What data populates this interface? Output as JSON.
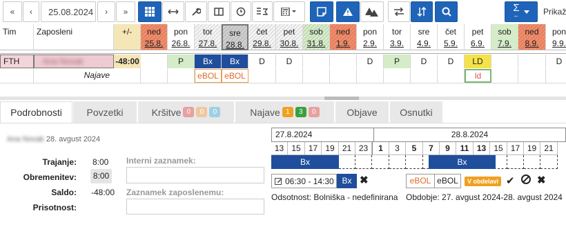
{
  "toolbar": {
    "date_value": "25.08.2024",
    "first_label": "«",
    "prev_label": "‹",
    "next_label": "›",
    "last_label": "»",
    "sigma_label": "Σ",
    "sigma_sub": "←",
    "prikaz_label": "Prikaž"
  },
  "header": {
    "tim": "Tim",
    "zaposleni": "Zaposleni",
    "balance": "+/-"
  },
  "days": [
    {
      "name": "ned",
      "date": "25.8.",
      "type": "holiday"
    },
    {
      "name": "pon",
      "date": "26.8.",
      "type": "normal"
    },
    {
      "name": "tor",
      "date": "27.8.",
      "type": "hatched"
    },
    {
      "name": "sre",
      "date": "28.8.",
      "type": "selected"
    },
    {
      "name": "čet",
      "date": "29.8.",
      "type": "hatched"
    },
    {
      "name": "pet",
      "date": "30.8.",
      "type": "hatched"
    },
    {
      "name": "sob",
      "date": "31.8.",
      "type": "weekend-hatched"
    },
    {
      "name": "ned",
      "date": "1.9.",
      "type": "holiday"
    },
    {
      "name": "pon",
      "date": "2.9.",
      "type": "normal"
    },
    {
      "name": "tor",
      "date": "3.9.",
      "type": "normal"
    },
    {
      "name": "sre",
      "date": "4.9.",
      "type": "normal"
    },
    {
      "name": "čet",
      "date": "5.9.",
      "type": "normal"
    },
    {
      "name": "pet",
      "date": "6.9.",
      "type": "normal"
    },
    {
      "name": "sob",
      "date": "7.9.",
      "type": "weekend"
    },
    {
      "name": "ned",
      "date": "8.9.",
      "type": "holiday"
    },
    {
      "name": "pon",
      "date": "9.9.",
      "type": "normal"
    }
  ],
  "employee": {
    "team": "FTH",
    "name": "Ana Novak",
    "balance": "-48:00",
    "najave": "Najave"
  },
  "schedule": [
    "",
    "P",
    "Bx",
    "Bx",
    "D",
    "D",
    "",
    "",
    "D",
    "P",
    "D",
    "D",
    "LD",
    "",
    "",
    "D"
  ],
  "najave": [
    "",
    "",
    "eBOL",
    "eBOL",
    "",
    "",
    "",
    "",
    "",
    "",
    "",
    "",
    "ld",
    "",
    "",
    ""
  ],
  "colors": {
    "accent": "#1f64b8",
    "holiday": "#f28c6a",
    "weekend": "#d5ecc8",
    "bx": "#1f4e9c",
    "eBOL": "#e06a2a",
    "yellow": "#f5e24a"
  },
  "tabs": [
    {
      "label": "Podrobnosti",
      "active": true,
      "badges": []
    },
    {
      "label": "Povzetki",
      "active": false,
      "badges": []
    },
    {
      "label": "Kršitve",
      "active": false,
      "badges": [
        {
          "v": "0",
          "c": "#e8a0a0"
        },
        {
          "v": "0",
          "c": "#f0c8a0"
        },
        {
          "v": "0",
          "c": "#9dd0e4"
        }
      ]
    },
    {
      "label": "Najave",
      "active": false,
      "badges": [
        {
          "v": "1",
          "c": "#f0a020"
        },
        {
          "v": "3",
          "c": "#3aa040"
        },
        {
          "v": "0",
          "c": "#e8a0a0"
        }
      ]
    },
    {
      "label": "Objave",
      "active": false,
      "badges": []
    },
    {
      "label": "Osnutki",
      "active": false,
      "badges": []
    }
  ],
  "details": {
    "person": "Ana Novak",
    "date": "28. avgust 2024",
    "trajanje_label": "Trajanje:",
    "trajanje": "8:00",
    "obremenitev_label": "Obremenitev:",
    "obremenitev": "8:00",
    "saldo_label": "Saldo:",
    "saldo": "-48:00",
    "prisotnost_label": "Prisotnost:",
    "interni_label": "Interni zaznamek:",
    "zaznamek_label": "Zaznamek zaposlenemu:"
  },
  "timeline": {
    "day1": "27.8.2024",
    "day2": "28.8.2024",
    "hours1": [
      "13",
      "15",
      "17",
      "19",
      "21",
      "23"
    ],
    "hours2": [
      "1",
      "3",
      "5",
      "7",
      "9",
      "11",
      "13",
      "15",
      "17",
      "19",
      "21"
    ],
    "bar_label": "Bx"
  },
  "shift": {
    "time": "06:30 - 14:30",
    "code": "Bx",
    "code2_a": "eBOL",
    "code2_b": "eBOL",
    "badge": "V obdelavi",
    "odsotnost": "Odsotnost: Bolniška - nedefinirana",
    "obdobje": "Obdobje: 27. avgust 2024-28. avgust 2024"
  }
}
